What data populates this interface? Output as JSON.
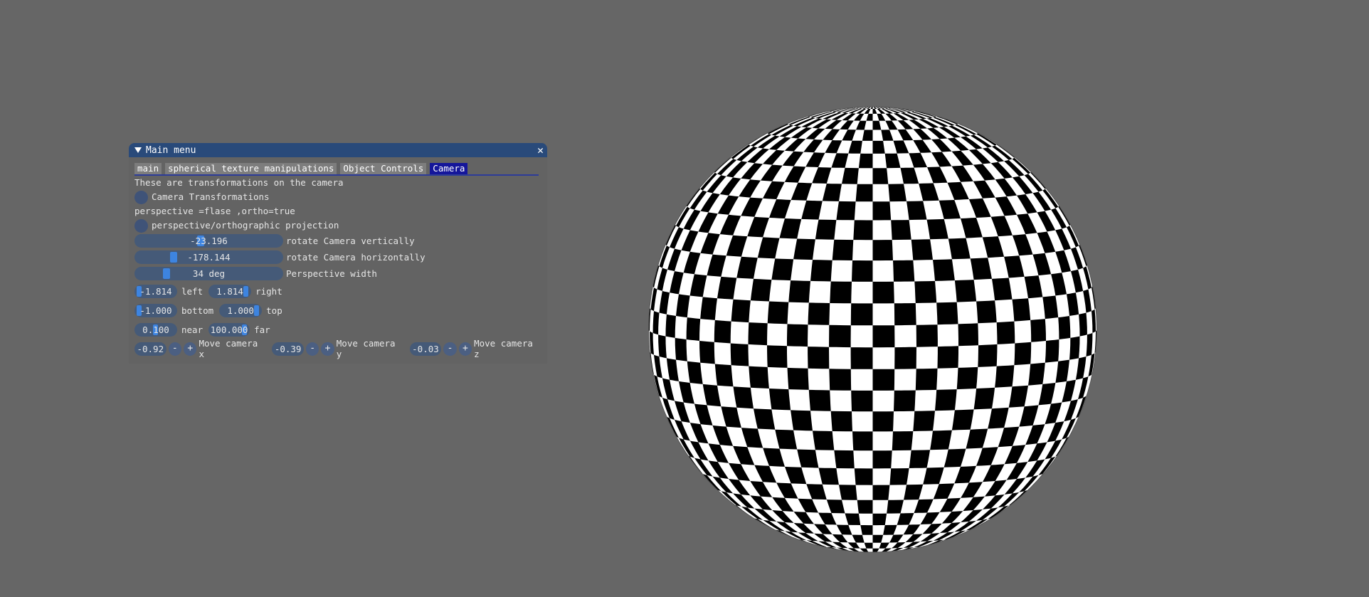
{
  "window": {
    "title": "Main menu",
    "close_icon": "close-icon",
    "collapse_icon": "collapse-arrow-icon"
  },
  "tabs": [
    {
      "label": "main",
      "active": false
    },
    {
      "label": "spherical texture manipulations",
      "active": false
    },
    {
      "label": "Object Controls",
      "active": false
    },
    {
      "label": "Camera",
      "active": true
    }
  ],
  "camera_tab": {
    "intro": "These are transformations on the camera",
    "camera_transformations_label": "Camera Transformations",
    "projection_note": "perspective =flase ,ortho=true",
    "projection_label": "perspective/orthographic projection",
    "sliders": [
      {
        "value": "-23.196",
        "label": "rotate Camera vertically",
        "fraction": 0.44
      },
      {
        "value": "-178.144",
        "label": "rotate Camera horizontally",
        "fraction": 0.25
      },
      {
        "value": "34 deg",
        "label": "Perspective width",
        "fraction": 0.2
      }
    ],
    "ortho_left": {
      "value": "-1.814",
      "label": "left"
    },
    "ortho_right": {
      "value": "1.814",
      "label": "right"
    },
    "ortho_bottom": {
      "value": "-1.000",
      "label": "bottom"
    },
    "ortho_top": {
      "value": "1.000",
      "label": "top"
    },
    "near": {
      "value": "0.100",
      "label": "near"
    },
    "far": {
      "value": "100.000",
      "label": "far"
    },
    "move_x": {
      "value": "-0.92",
      "label": "Move camera x"
    },
    "move_y": {
      "value": "-0.39",
      "label": "Move camera y"
    },
    "move_z": {
      "value": "-0.03",
      "label": "Move camera z"
    },
    "minus_label": "-",
    "plus_label": "+"
  },
  "viewport": {
    "object": "checkered-sphere",
    "colors": {
      "dark": "#000000",
      "light": "#ffffff",
      "background": "#666666"
    }
  },
  "colors": {
    "title_bar": "#294a7a",
    "active_tab": "#15169a",
    "frame_bg": "#455a78",
    "slider_grab": "#3d84e0"
  }
}
